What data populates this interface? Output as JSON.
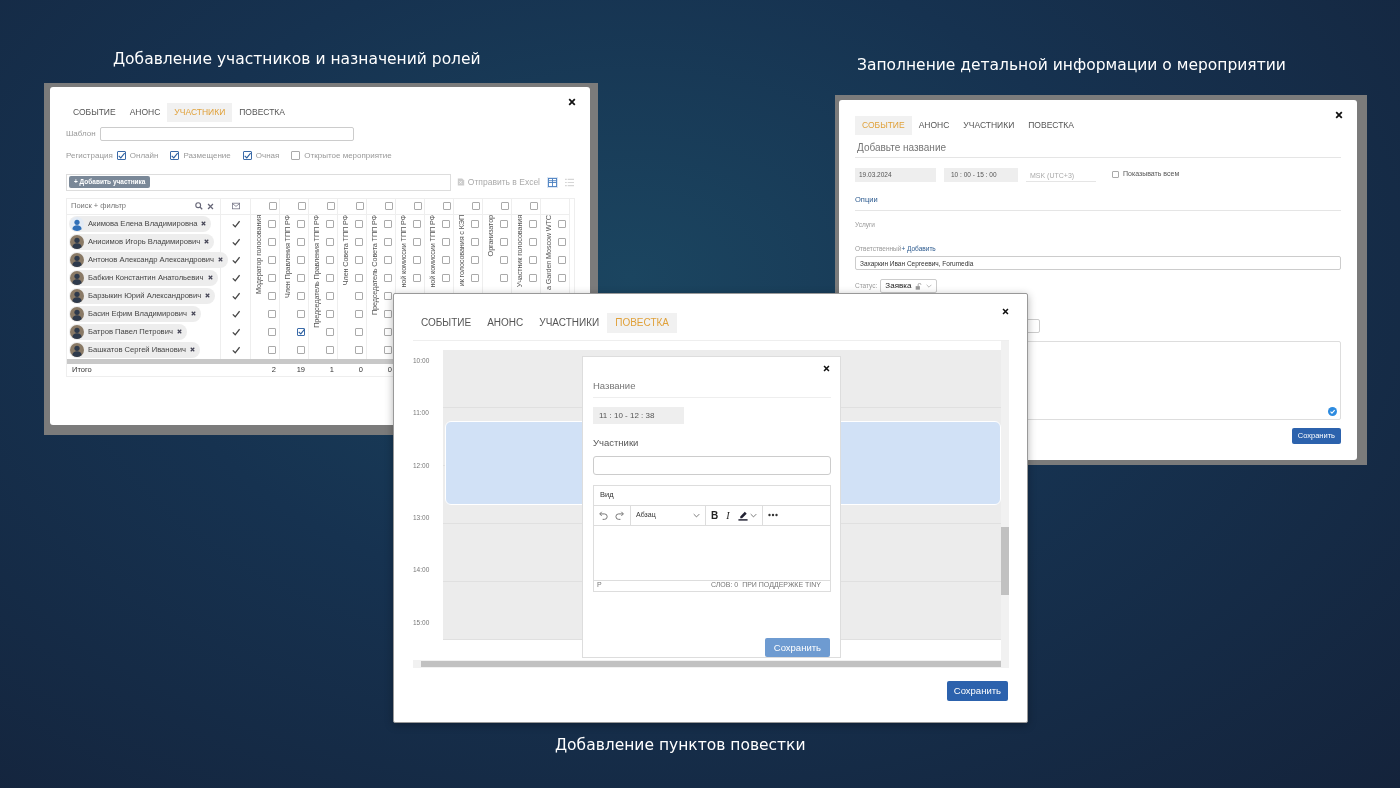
{
  "participants_screen": {
    "caption": "Добавление участников и назначений ролей",
    "tabs": [
      {
        "label": "СОБЫТИЕ",
        "selected": false
      },
      {
        "label": "АНОНС",
        "selected": false
      },
      {
        "label": "УЧАСТНИКИ",
        "selected": true
      },
      {
        "label": "ПОВЕСТКА",
        "selected": false
      }
    ],
    "template_label": "Шаблон",
    "registration": {
      "label": "Регистрация",
      "options": [
        {
          "label": "Онлайн",
          "checked": true
        },
        {
          "label": "Размещение",
          "checked": true
        },
        {
          "label": "Очная",
          "checked": true
        },
        {
          "label": "Открытое мероприятие",
          "checked": false
        }
      ]
    },
    "add_button": "+ Добавить участника",
    "export_link": "Отправить в Excel",
    "view_modes": [
      {
        "kind": "grid",
        "selected": true
      },
      {
        "kind": "list",
        "selected": false
      }
    ],
    "table": {
      "filter_placeholder": "Поиск + фильтр",
      "total_label": "Итого",
      "participants": [
        {
          "name": "Акимова Елена Владимировна",
          "kind": "placeholder",
          "invited": true
        },
        {
          "name": "Анисимов Игорь Владимирович",
          "kind": "photo",
          "invited": true
        },
        {
          "name": "Антонов Александр Александрович",
          "kind": "photo",
          "invited": true
        },
        {
          "name": "Бабкин Константин Анатольевич",
          "kind": "photo",
          "invited": true
        },
        {
          "name": "Барзыкин Юрий Александрович",
          "kind": "photo",
          "invited": true
        },
        {
          "name": "Басин Ефим Владимирович",
          "kind": "photo",
          "invited": true
        },
        {
          "name": "Батров Павел Петрович",
          "kind": "photo",
          "invited": true
        },
        {
          "name": "Башкатов Сергей Иванович",
          "kind": "photo",
          "invited": true
        }
      ],
      "roles": [
        {
          "header": "Модератор голосования",
          "select_all": {
            "checked": false
          },
          "cells": [
            {
              "checked": false
            },
            {
              "checked": false
            },
            {
              "checked": false
            },
            {
              "checked": false
            },
            {
              "checked": false
            },
            {
              "checked": false
            },
            {
              "checked": false
            },
            {
              "checked": false
            }
          ],
          "total": "2"
        },
        {
          "header": "Член Правления ТПП РФ",
          "select_all": {
            "checked": false
          },
          "cells": [
            {
              "checked": false
            },
            {
              "checked": false
            },
            {
              "checked": false
            },
            {
              "checked": false
            },
            {
              "checked": false
            },
            {
              "checked": false
            },
            {
              "checked": true
            },
            {
              "checked": false
            }
          ],
          "total": "19"
        },
        {
          "header": "Председатель Правления ТПП РФ",
          "select_all": {
            "checked": false
          },
          "cells": [
            {
              "checked": false
            },
            {
              "checked": false
            },
            {
              "checked": false
            },
            {
              "checked": false
            },
            {
              "checked": false
            },
            {
              "checked": false
            },
            {
              "checked": false
            },
            {
              "checked": false
            }
          ],
          "total": "1"
        },
        {
          "header": "Член Совета ТПП РФ",
          "select_all": {
            "checked": false
          },
          "cells": [
            {
              "checked": false
            },
            {
              "checked": false
            },
            {
              "checked": false
            },
            {
              "checked": false
            },
            {
              "checked": false
            },
            {
              "checked": false
            },
            {
              "checked": false
            },
            {
              "checked": false
            }
          ],
          "total": "0"
        },
        {
          "header": "Председатель Совета ТПП РФ",
          "select_all": {
            "checked": false
          },
          "cells": [
            {
              "checked": false
            },
            {
              "checked": false
            },
            {
              "checked": false
            },
            {
              "checked": false
            },
            {
              "checked": false
            },
            {
              "checked": false
            },
            {
              "checked": false
            },
            {
              "checked": false
            }
          ],
          "total": "0"
        },
        {
          "header": "ной комиссии ТПП РФ",
          "select_all": {
            "checked": false
          },
          "cells": [
            {
              "checked": false
            },
            {
              "checked": false
            },
            {
              "checked": false
            },
            {
              "checked": false
            }
          ]
        },
        {
          "header": "ной комиссии ТПП РФ",
          "select_all": {
            "checked": false
          },
          "cells": [
            {
              "checked": false
            },
            {
              "checked": false
            },
            {
              "checked": false
            },
            {
              "checked": false
            }
          ]
        },
        {
          "header": "ик голосования с КЭП",
          "select_all": {
            "checked": false
          },
          "cells": [
            {
              "checked": false
            },
            {
              "checked": false
            },
            {
              "checked": false
            },
            {
              "checked": false
            }
          ]
        },
        {
          "header": "Организатор",
          "select_all": {
            "checked": false
          },
          "cells": [
            {
              "checked": false
            },
            {
              "checked": false
            },
            {
              "checked": false
            },
            {
              "checked": false
            }
          ]
        },
        {
          "header": "Участник голосования",
          "select_all": {
            "checked": false
          },
          "cells": [
            {
              "checked": false
            },
            {
              "checked": false
            },
            {
              "checked": false
            },
            {
              "checked": false
            }
          ]
        },
        {
          "header": "a Garden Moscow WTC",
          "cells": [
            {
              "checked": false
            },
            {
              "checked": false
            },
            {
              "checked": false
            },
            {
              "checked": false
            }
          ]
        }
      ]
    }
  },
  "event_screen": {
    "caption": "Заполнение детальной информации о мероприятии",
    "tabs": [
      {
        "label": "СОБЫТИЕ",
        "selected": true
      },
      {
        "label": "АНОНС",
        "selected": false
      },
      {
        "label": "УЧАСТНИКИ",
        "selected": false
      },
      {
        "label": "ПОВЕСТКА",
        "selected": false
      }
    ],
    "title_placeholder": "Добавьте название",
    "date": "19.03.2024",
    "time": "10 : 00 - 15 : 00",
    "timezone": "MSK (UTC+3)",
    "show_all": {
      "label": "Показывать всем",
      "checked": false
    },
    "options_link": "Опции",
    "services_label": "Услуги",
    "responsible": {
      "label": "Ответственный",
      "add_link": "+ Добавить",
      "value": "Захаркин Иван Сергеевич, Forumedia"
    },
    "status": {
      "label": "Статус:",
      "value": "Заявка"
    },
    "save": "Сохранить"
  },
  "agenda_screen": {
    "caption": "Добавление пунктов повестки",
    "tabs": [
      {
        "label": "СОБЫТИЕ",
        "selected": false
      },
      {
        "label": "АНОНС",
        "selected": false
      },
      {
        "label": "УЧАСТНИКИ",
        "selected": false
      },
      {
        "label": "ПОВЕСТКА",
        "selected": true
      }
    ],
    "hours": [
      "10:00",
      "11:00",
      "12:00",
      "13:00",
      "14:00",
      "15:00"
    ],
    "popup": {
      "title_placeholder": "Название",
      "time": "11 : 10 - 12 : 38",
      "participants_label": "Участники",
      "editor": {
        "menu": [
          "Вид"
        ],
        "block_format": "Абзац",
        "format_buttons": [
          "B",
          "I"
        ],
        "path": "P",
        "status": "СЛОВ: 0  ПРИ ПОДДЕРЖКЕ TINY"
      },
      "save": "Сохранить"
    },
    "save": "Сохранить"
  }
}
